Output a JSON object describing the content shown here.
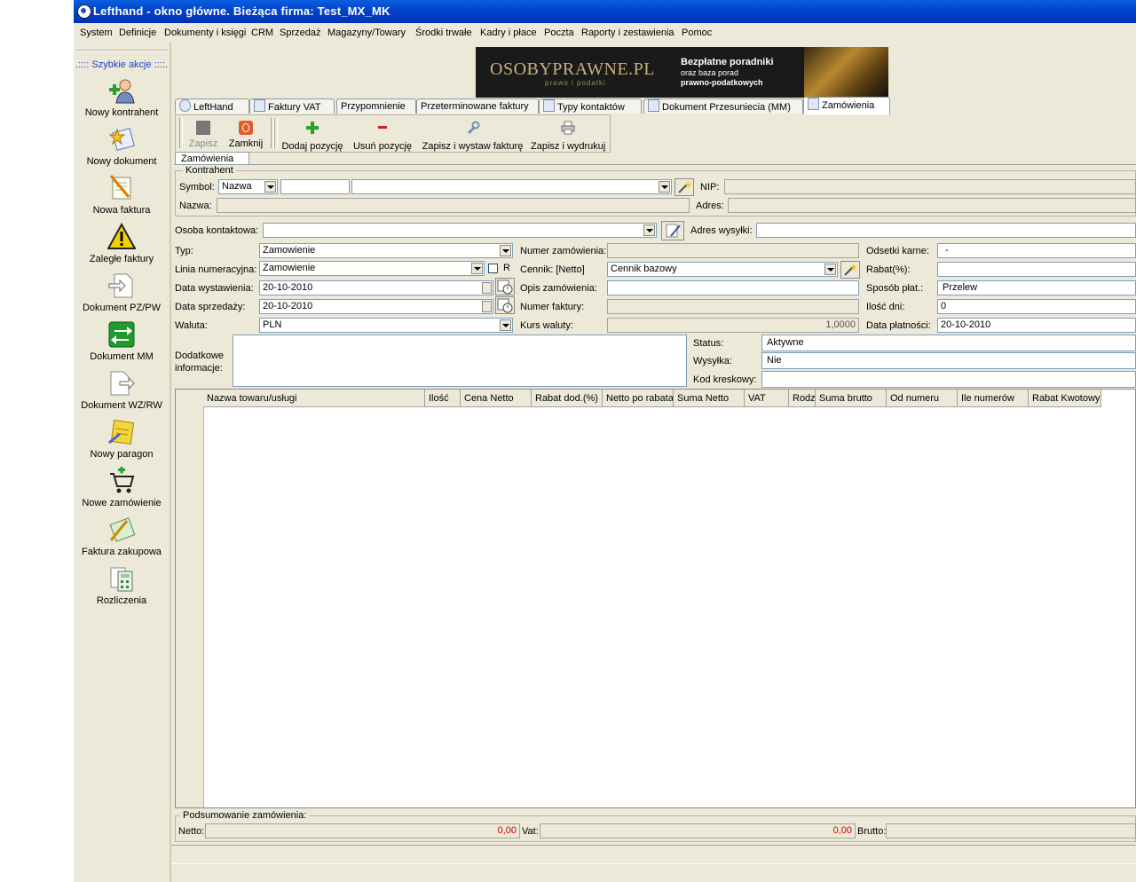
{
  "window": {
    "title": "Lefthand - okno główne. Bieżąca firma: Test_MX_MK"
  },
  "menu": [
    "System",
    "Definicje",
    "Dokumenty i księgi",
    "CRM",
    "Sprzedaż",
    "Magazyny/Towary",
    "Środki trwałe",
    "Kadry i płace",
    "Poczta",
    "Raporty i zestawienia",
    "Pomoc"
  ],
  "sidebar": {
    "header": ".:::: Szybkie akcje ::::.",
    "items": [
      {
        "label": "Nowy kontrahent",
        "icon": "person-add-icon"
      },
      {
        "label": "Nowy dokument",
        "icon": "document-star-icon"
      },
      {
        "label": "Nowa faktura",
        "icon": "invoice-pen-icon"
      },
      {
        "label": "Zaległe faktury",
        "icon": "warning-icon"
      },
      {
        "label": "Dokument PZ/PW",
        "icon": "document-arrow-in-icon"
      },
      {
        "label": "Dokument MM",
        "icon": "transfer-arrows-icon"
      },
      {
        "label": "Dokument WZ/RW",
        "icon": "document-arrow-out-icon"
      },
      {
        "label": "Nowy paragon",
        "icon": "receipt-icon"
      },
      {
        "label": "Nowe zamówienie",
        "icon": "cart-add-icon"
      },
      {
        "label": "Faktura zakupowa",
        "icon": "purchase-invoice-icon"
      },
      {
        "label": "Rozliczenia",
        "icon": "calculator-icon"
      }
    ]
  },
  "banner": {
    "logo": "OSOBYPRAWNE.PL",
    "logo_sub": "prawo i podatki",
    "line1": "Bezpłatne poradniki",
    "line2": "oraz baza porad",
    "line3": "prawno-podatkowych"
  },
  "tabs": [
    "LeftHand",
    "Faktury VAT",
    "Przypomnienie",
    "Przeterminowane faktury",
    "Typy kontaktów",
    "Dokument Przesuniecia (MM)",
    "Zamówienia"
  ],
  "toolbar": {
    "save": "Zapisz",
    "close": "Zamknij",
    "add_item": "Dodaj pozycję",
    "remove_item": "Usuń pozycję",
    "save_invoice": "Zapisz i wystaw fakturę",
    "save_print": "Zapisz i wydrukuj"
  },
  "inner_tab": "Zamówienia",
  "contractor": {
    "group_title": "Kontrahent",
    "symbol_label": "Symbol:",
    "symbol_mode": "Nazwa",
    "nip_label": "NIP:",
    "name_label": "Nazwa:",
    "address_label": "Adres:"
  },
  "contact": {
    "label": "Osoba kontaktowa:",
    "shipping_label": "Adres wysyłki:"
  },
  "form": {
    "type_label": "Typ:",
    "type_value": "Zamowienie",
    "numbering_label": "Linia numeracyjna:",
    "numbering_value": "Zamowienie",
    "numbering_check": "R",
    "issue_date_label": "Data wystawienia:",
    "issue_date": "20-10-2010",
    "sale_date_label": "Data sprzedaży:",
    "sale_date": "20-10-2010",
    "currency_label": "Waluta:",
    "currency": "PLN",
    "order_no_label": "Numer zamówienia:",
    "pricelist_label": "Cennik: [Netto]",
    "pricelist": "Cennik bazowy",
    "order_desc_label": "Opis zamówienia:",
    "invoice_no_label": "Numer faktury:",
    "rate_label": "Kurs waluty:",
    "rate": "1,0000",
    "penalty_label": "Odsetki karne:",
    "penalty": "-",
    "discount_label": "Rabat(%):",
    "payment_label": "Sposób płat.:",
    "payment": "Przelew",
    "days_label": "Ilość dni:",
    "days": "0",
    "payment_date_label": "Data płatności:",
    "payment_date": "20-10-2010",
    "extra_info_label": "Dodatkowe informacje:",
    "status_label": "Status:",
    "status": "Aktywne",
    "shipping_label": "Wysyłka:",
    "shipping": "Nie",
    "barcode_label": "Kod kreskowy:"
  },
  "grid": {
    "columns": [
      "Nazwa towaru/usługi",
      "Ilość",
      "Cena Netto",
      "Rabat dod.(%)",
      "Netto po rabata",
      "Suma Netto",
      "VAT",
      "Rodz",
      "Suma brutto",
      "Od numeru",
      "Ile numerów",
      "Rabat Kwotowy"
    ]
  },
  "summary": {
    "title": "Podsumowanie zamówienia:",
    "netto_label": "Netto:",
    "netto": "0,00",
    "vat_label": "Vat:",
    "vat": "0,00",
    "brutto_label": "Brutto:"
  }
}
